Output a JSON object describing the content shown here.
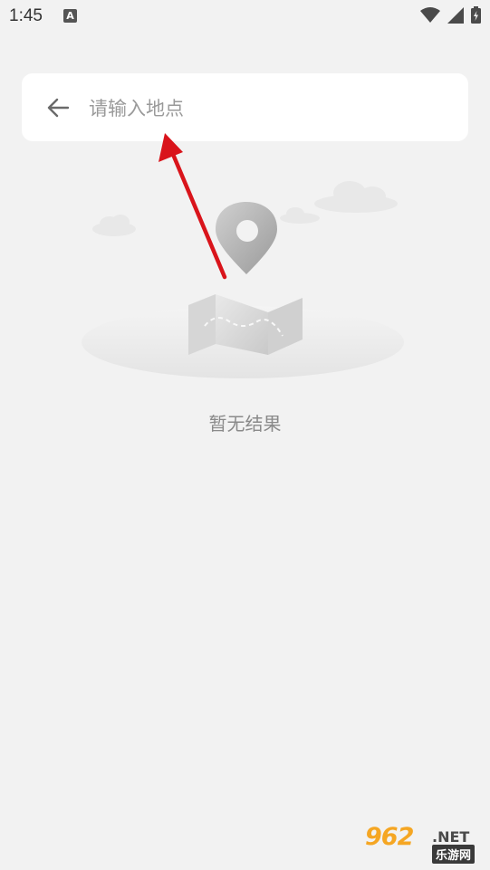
{
  "status_bar": {
    "time": "1:45",
    "app_icon_letter": "A",
    "icons": [
      "wifi-icon",
      "signal-icon",
      "battery-icon"
    ]
  },
  "search": {
    "placeholder": "请输入地点",
    "value": ""
  },
  "empty_state": {
    "message": "暂无结果"
  },
  "watermark": {
    "number": "962",
    "domain": ".NET",
    "site_name": "乐游网"
  },
  "colors": {
    "background": "#f2f2f2",
    "card": "#ffffff",
    "annotation_arrow": "#d9141b",
    "watermark_orange": "#f5a623"
  }
}
